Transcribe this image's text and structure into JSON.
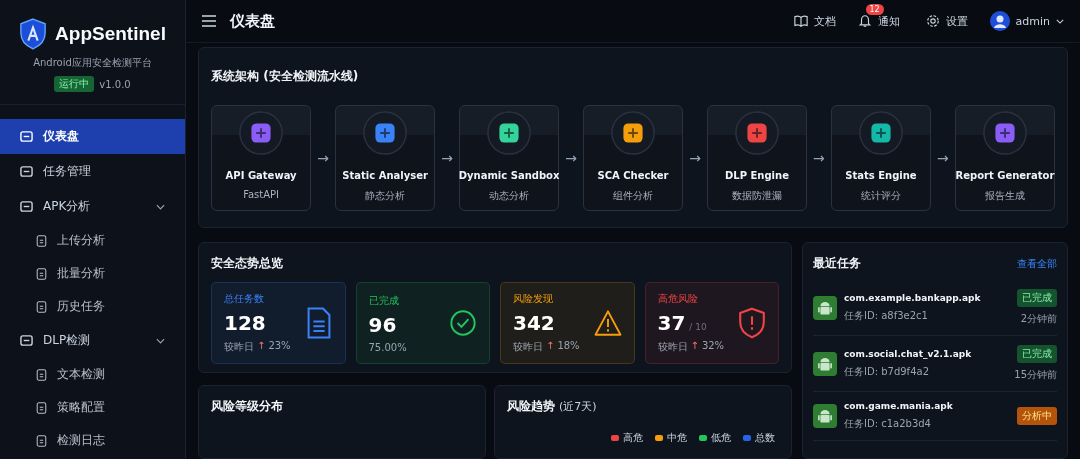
{
  "brand": {
    "name": "AppSentinel",
    "subtitle": "Android应用安全检测平台",
    "status": "运行中",
    "version": "v1.0.0"
  },
  "sidebar": {
    "items": [
      {
        "label": "仪表盘",
        "selected": true
      },
      {
        "label": "任务管理",
        "selected": false
      },
      {
        "label": "APK分析",
        "selected": false,
        "expanded": true,
        "children": [
          {
            "label": "上传分析",
            "selected": false
          },
          {
            "label": "批量分析",
            "selected": false
          },
          {
            "label": "历史任务",
            "selected": false
          }
        ]
      },
      {
        "label": "DLP检测",
        "selected": false,
        "expanded": true,
        "children": [
          {
            "label": "文本检测",
            "selected": false
          },
          {
            "label": "策略配置",
            "selected": false
          },
          {
            "label": "检测日志",
            "selected": false
          }
        ]
      }
    ]
  },
  "header": {
    "title": "仪表盘",
    "actions": [
      {
        "label": "文档"
      },
      {
        "label": "通知",
        "badge": "12"
      },
      {
        "label": "设置"
      }
    ],
    "user": "admin"
  },
  "pipeline": {
    "title": "系统架构 (安全检测流水线)",
    "stages": [
      {
        "name": "API Gateway",
        "sub": "FastAPI",
        "color": "#8b5cf6"
      },
      {
        "name": "Static Analyser",
        "sub": "静态分析",
        "color": "#3b82f6"
      },
      {
        "name": "Dynamic Sandbox",
        "sub": "动态分析",
        "color": "#34d399"
      },
      {
        "name": "SCA Checker",
        "sub": "组件分析",
        "color": "#f59e0b"
      },
      {
        "name": "DLP Engine",
        "sub": "数据防泄漏",
        "color": "#ef4444"
      },
      {
        "name": "Stats Engine",
        "sub": "统计评分",
        "color": "#14b8a6"
      },
      {
        "name": "Report Generator",
        "sub": "报告生成",
        "color": "#8b5cf6"
      }
    ],
    "arrow": "→"
  },
  "overview": {
    "title": "安全态势总览",
    "cards": [
      {
        "kind": "trend",
        "label": "总任务数",
        "value": "128",
        "compare": "较昨日",
        "arrow": "↑",
        "change": "23%",
        "color": "#3b82f6"
      },
      {
        "kind": "plain",
        "label": "已完成",
        "value": "96",
        "note": "75.00%",
        "color": "#22c55e"
      },
      {
        "kind": "trend",
        "label": "风险发现",
        "value": "342",
        "compare": "较昨日",
        "arrow": "↑",
        "change": "18%",
        "color": "#f59e0b"
      },
      {
        "kind": "trend",
        "label": "高危风险",
        "value": "37",
        "suffix": "/ 10",
        "compare": "较昨日",
        "arrow": "↑",
        "change": "32%",
        "color": "#ef4444"
      }
    ]
  },
  "distribution": {
    "title": "风险等级分布"
  },
  "trend": {
    "title": "风险趋势",
    "title_note": "(近7天)",
    "legend": [
      {
        "label": "高危",
        "color": "#ef4444"
      },
      {
        "label": "中危",
        "color": "#f59e0b"
      },
      {
        "label": "低危",
        "color": "#22c55e"
      },
      {
        "label": "总数",
        "color": "#2563eb"
      }
    ]
  },
  "recent": {
    "title": "最近任务",
    "link": "查看全部",
    "tasks": [
      {
        "name": "com.example.bankapp.apk",
        "task_id": "任务ID: a8f3e2c1",
        "status": "已完成",
        "completed": true,
        "time": "2分钟前"
      },
      {
        "name": "com.social.chat_v2.1.apk",
        "task_id": "任务ID: b7d9f4a2",
        "status": "已完成",
        "completed": true,
        "time": "15分钟前"
      },
      {
        "name": "com.game.mania.apk",
        "task_id": "任务ID: c1a2b3d4",
        "status": "分析中",
        "completed": false
      }
    ]
  }
}
